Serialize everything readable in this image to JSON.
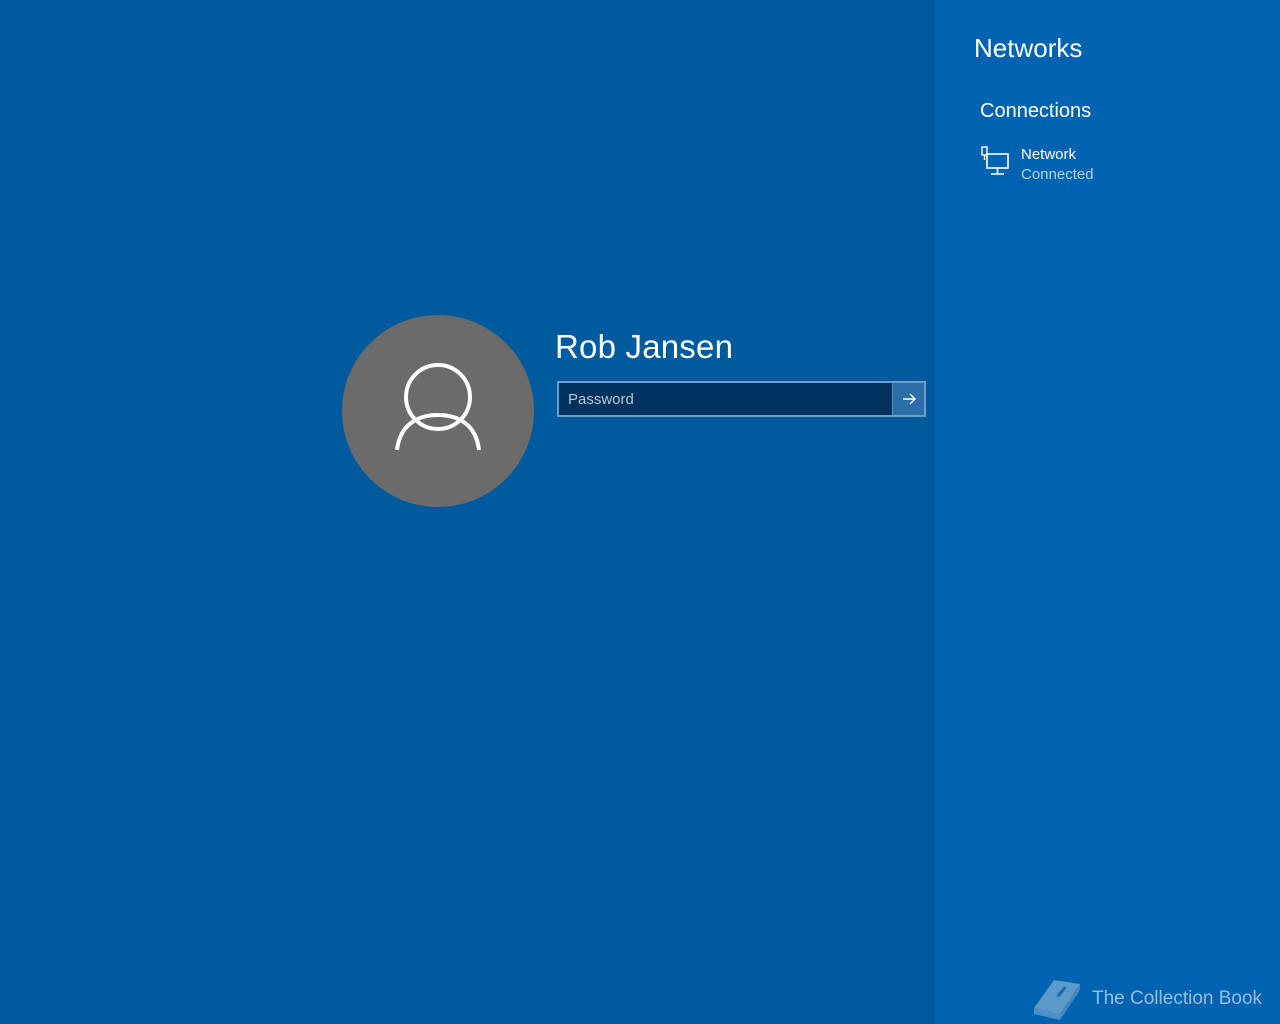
{
  "login": {
    "user_name": "Rob Jansen",
    "password_placeholder": "Password",
    "password_value": ""
  },
  "networks_panel": {
    "title": "Networks",
    "section_title": "Connections",
    "connections": [
      {
        "name": "Network",
        "status": "Connected",
        "icon": "wired-network-icon"
      }
    ]
  },
  "watermark": {
    "text": "The Collection Book",
    "icon": "book-icon"
  },
  "colors": {
    "background": "#005a9e",
    "panel_background": "#0063b1",
    "avatar_background": "#6b6b6b",
    "input_background": "#003260",
    "input_border": "#6a9fcc"
  }
}
